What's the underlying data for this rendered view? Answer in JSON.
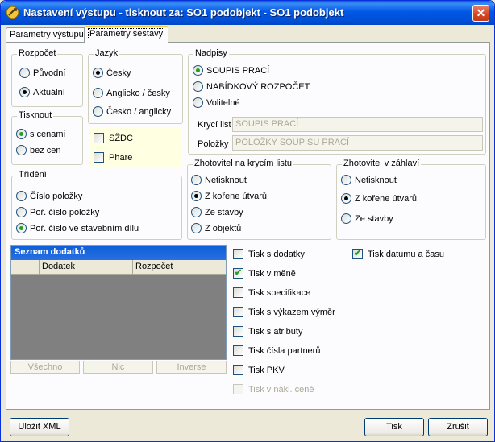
{
  "window": {
    "title": "Nastavení výstupu - tisknout za: SO1 podobjekt - SO1 podobjekt",
    "close_glyph": "✕"
  },
  "tabs": [
    {
      "label": "Parametry výstupu",
      "active": false
    },
    {
      "label": "Parametry sestavy",
      "active": true
    }
  ],
  "rozpocet": {
    "title": "Rozpočet",
    "options": [
      {
        "label": "Původní",
        "checked": false
      },
      {
        "label": "Aktuální",
        "checked": true
      }
    ]
  },
  "jazyk": {
    "title": "Jazyk",
    "options": [
      {
        "label": "Česky",
        "checked": true
      },
      {
        "label": "Anglicko / česky",
        "checked": false
      },
      {
        "label": "Česko / anglicky",
        "checked": false
      }
    ]
  },
  "nadpisy": {
    "title": "Nadpisy",
    "options": [
      {
        "label": "SOUPIS PRACÍ",
        "checked": true
      },
      {
        "label": "NABÍDKOVÝ ROZPOČET",
        "checked": false
      },
      {
        "label": "Volitelné",
        "checked": false
      }
    ],
    "kryci_list_label": "Krycí list",
    "kryci_list_value": "SOUPIS PRACÍ",
    "polozky_label": "Položky",
    "polozky_value": "POLOŽKY SOUPISU PRACÍ"
  },
  "tisknout": {
    "title": "Tisknout",
    "options": [
      {
        "label": "s cenami",
        "checked": true
      },
      {
        "label": "bez cen",
        "checked": false
      }
    ]
  },
  "extra_checks": [
    {
      "label": "SŽDC",
      "checked": false
    },
    {
      "label": "Phare",
      "checked": false
    }
  ],
  "trideni": {
    "title": "Třídění",
    "options": [
      {
        "label": "Číslo položky",
        "checked": false
      },
      {
        "label": "Poř. číslo položky",
        "checked": false
      },
      {
        "label": "Poř. číslo ve stavebním dílu",
        "checked": true
      }
    ]
  },
  "zhotovitel_krycim": {
    "title": "Zhotovitel na krycím listu",
    "options": [
      {
        "label": "Netisknout",
        "checked": false
      },
      {
        "label": "Z kořene útvarů",
        "checked": true
      },
      {
        "label": "Ze stavby",
        "checked": false
      },
      {
        "label": "Z objektů",
        "checked": false
      }
    ]
  },
  "zhotovitel_zahlavi": {
    "title": "Zhotovitel v záhlaví",
    "options": [
      {
        "label": "Netisknout",
        "checked": false
      },
      {
        "label": "Z kořene útvarů",
        "checked": true
      },
      {
        "label": "Ze stavby",
        "checked": false
      }
    ]
  },
  "seznam_dodatku": {
    "title": "Seznam dodatků",
    "columns": [
      "",
      "Dodatek",
      "Rozpočet"
    ],
    "buttons": [
      "Všechno",
      "Nic",
      "Inverse"
    ]
  },
  "print_checks": [
    {
      "label": "Tisk s dodatky",
      "checked": false,
      "disabled": false
    },
    {
      "label": "Tisk v měně",
      "checked": true,
      "disabled": false
    },
    {
      "label": "Tisk specifikace",
      "checked": false,
      "disabled": false
    },
    {
      "label": "Tisk s výkazem výměr",
      "checked": false,
      "disabled": false
    },
    {
      "label": "Tisk s atributy",
      "checked": false,
      "disabled": false
    },
    {
      "label": "Tisk čísla partnerů",
      "checked": false,
      "disabled": false
    },
    {
      "label": "Tisk PKV",
      "checked": false,
      "disabled": false
    },
    {
      "label": "Tisk v nákl. ceně",
      "checked": false,
      "disabled": true
    }
  ],
  "tisk_datumu": {
    "label": "Tisk datumu a času",
    "checked": true
  },
  "footer": {
    "save_xml": "Uložit XML",
    "print": "Tisk",
    "cancel": "Zrušit"
  },
  "check_glyph": "✔"
}
